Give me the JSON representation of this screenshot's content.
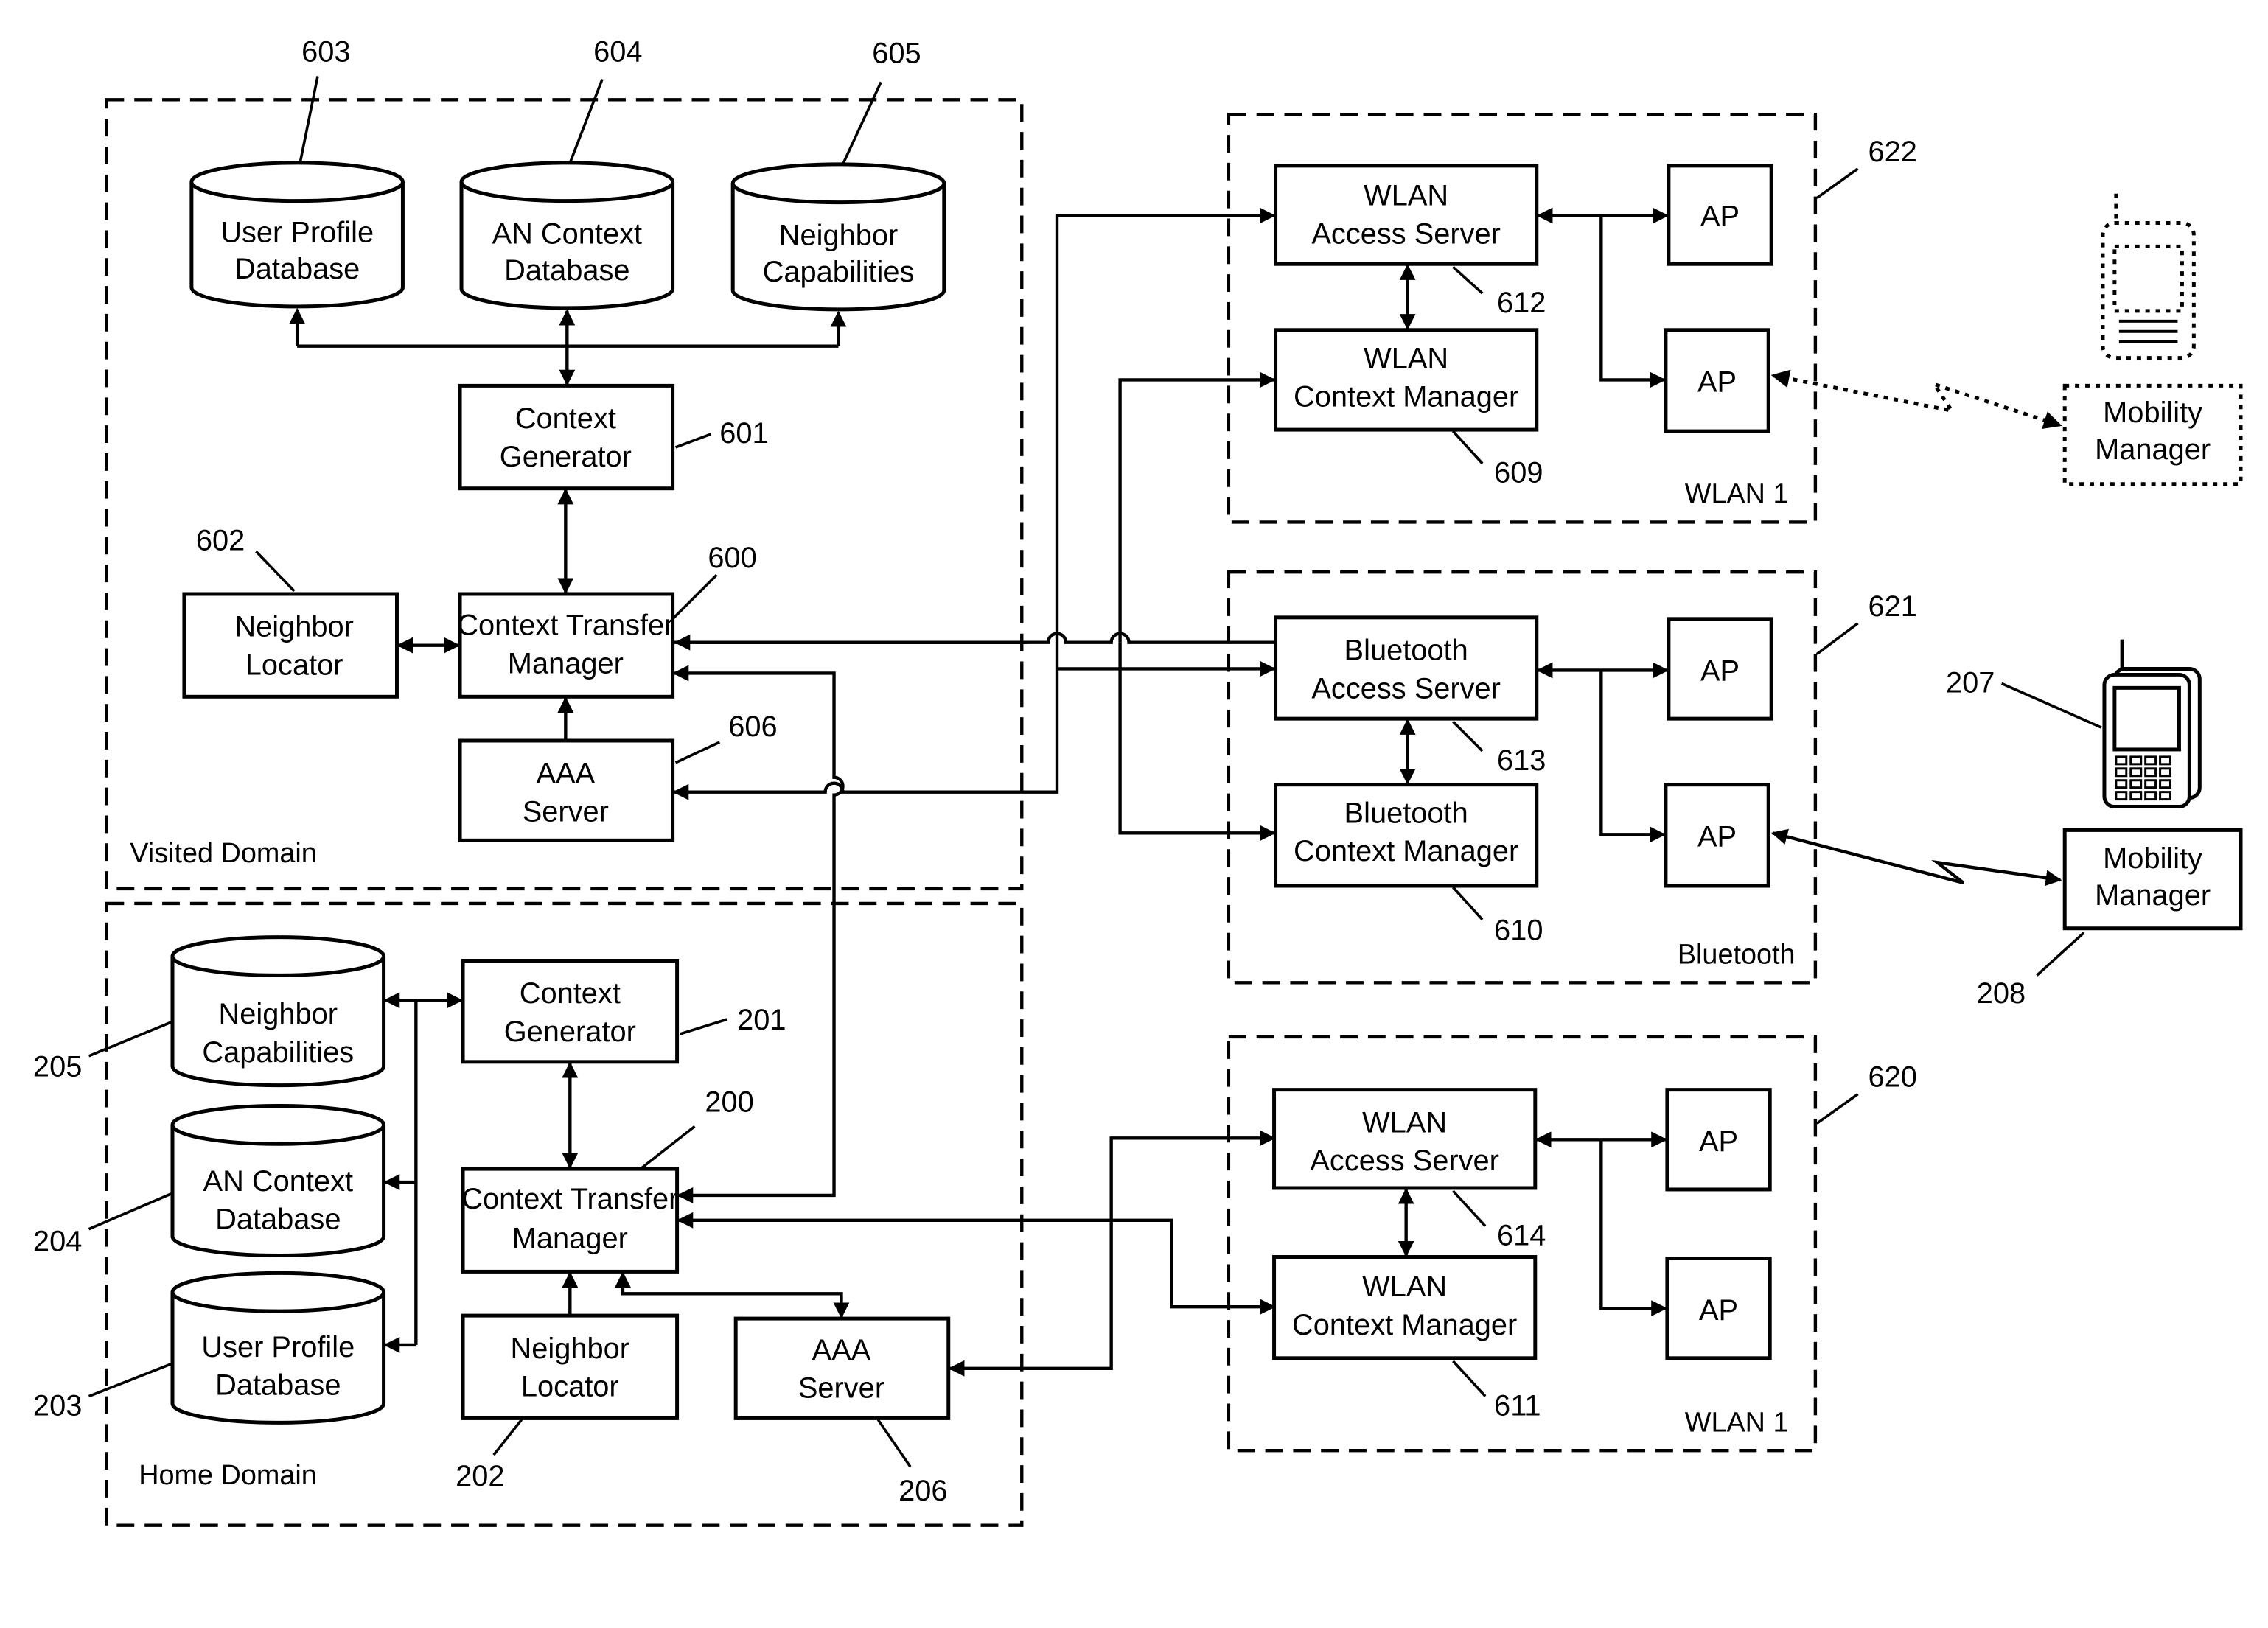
{
  "diagram": {
    "visited_domain": {
      "label": "Visited Domain",
      "user_profile_db": {
        "line1": "User Profile",
        "line2": "Database",
        "ref": "603"
      },
      "an_context_db": {
        "line1": "AN Context",
        "line2": "Database",
        "ref": "604"
      },
      "neighbor_capabilities": {
        "line1": "Neighbor",
        "line2": "Capabilities",
        "ref": "605"
      },
      "context_generator": {
        "line1": "Context",
        "line2": "Generator",
        "ref": "601"
      },
      "neighbor_locator": {
        "line1": "Neighbor",
        "line2": "Locator",
        "ref": "602"
      },
      "context_transfer_manager": {
        "line1": "Context Transfer",
        "line2": "Manager",
        "ref": "600"
      },
      "aaa_server": {
        "line1": "AAA",
        "line2": "Server",
        "ref": "606"
      }
    },
    "home_domain": {
      "label": "Home Domain",
      "neighbor_capabilities": {
        "line1": "Neighbor",
        "line2": "Capabilities",
        "ref": "205"
      },
      "an_context_db": {
        "line1": "AN Context",
        "line2": "Database",
        "ref": "204"
      },
      "user_profile_db": {
        "line1": "User Profile",
        "line2": "Database",
        "ref": "203"
      },
      "context_generator": {
        "line1": "Context",
        "line2": "Generator",
        "ref": "201"
      },
      "context_transfer_manager": {
        "line1": "Context Transfer",
        "line2": "Manager",
        "ref": "200"
      },
      "neighbor_locator": {
        "line1": "Neighbor",
        "line2": "Locator",
        "ref": "202"
      },
      "aaa_server": {
        "line1": "AAA",
        "line2": "Server",
        "ref": "206"
      }
    },
    "network_622": {
      "label": "WLAN 1",
      "ref": "622",
      "access_server": {
        "line1": "WLAN",
        "line2": "Access Server",
        "ref": "612"
      },
      "context_manager": {
        "line1": "WLAN",
        "line2": "Context Manager",
        "ref": "609"
      },
      "ap1": "AP",
      "ap2": "AP"
    },
    "network_621": {
      "label": "Bluetooth",
      "ref": "621",
      "access_server": {
        "line1": "Bluetooth",
        "line2": "Access Server",
        "ref": "613"
      },
      "context_manager": {
        "line1": "Bluetooth",
        "line2": "Context Manager",
        "ref": "610"
      },
      "ap1": "AP",
      "ap2": "AP"
    },
    "network_620": {
      "label": "WLAN 1",
      "ref": "620",
      "access_server": {
        "line1": "WLAN",
        "line2": "Access Server",
        "ref": "614"
      },
      "context_manager": {
        "line1": "WLAN",
        "line2": "Context Manager",
        "ref": "611"
      },
      "ap1": "AP",
      "ap2": "AP"
    },
    "mobile_device": {
      "ref": "207",
      "icon": "mobile-phone-icon"
    },
    "mobility_manager": {
      "line1": "Mobility",
      "line2": "Manager",
      "ref": "208"
    },
    "mobility_manager_ghost": {
      "line1": "Mobility",
      "line2": "Manager"
    }
  }
}
